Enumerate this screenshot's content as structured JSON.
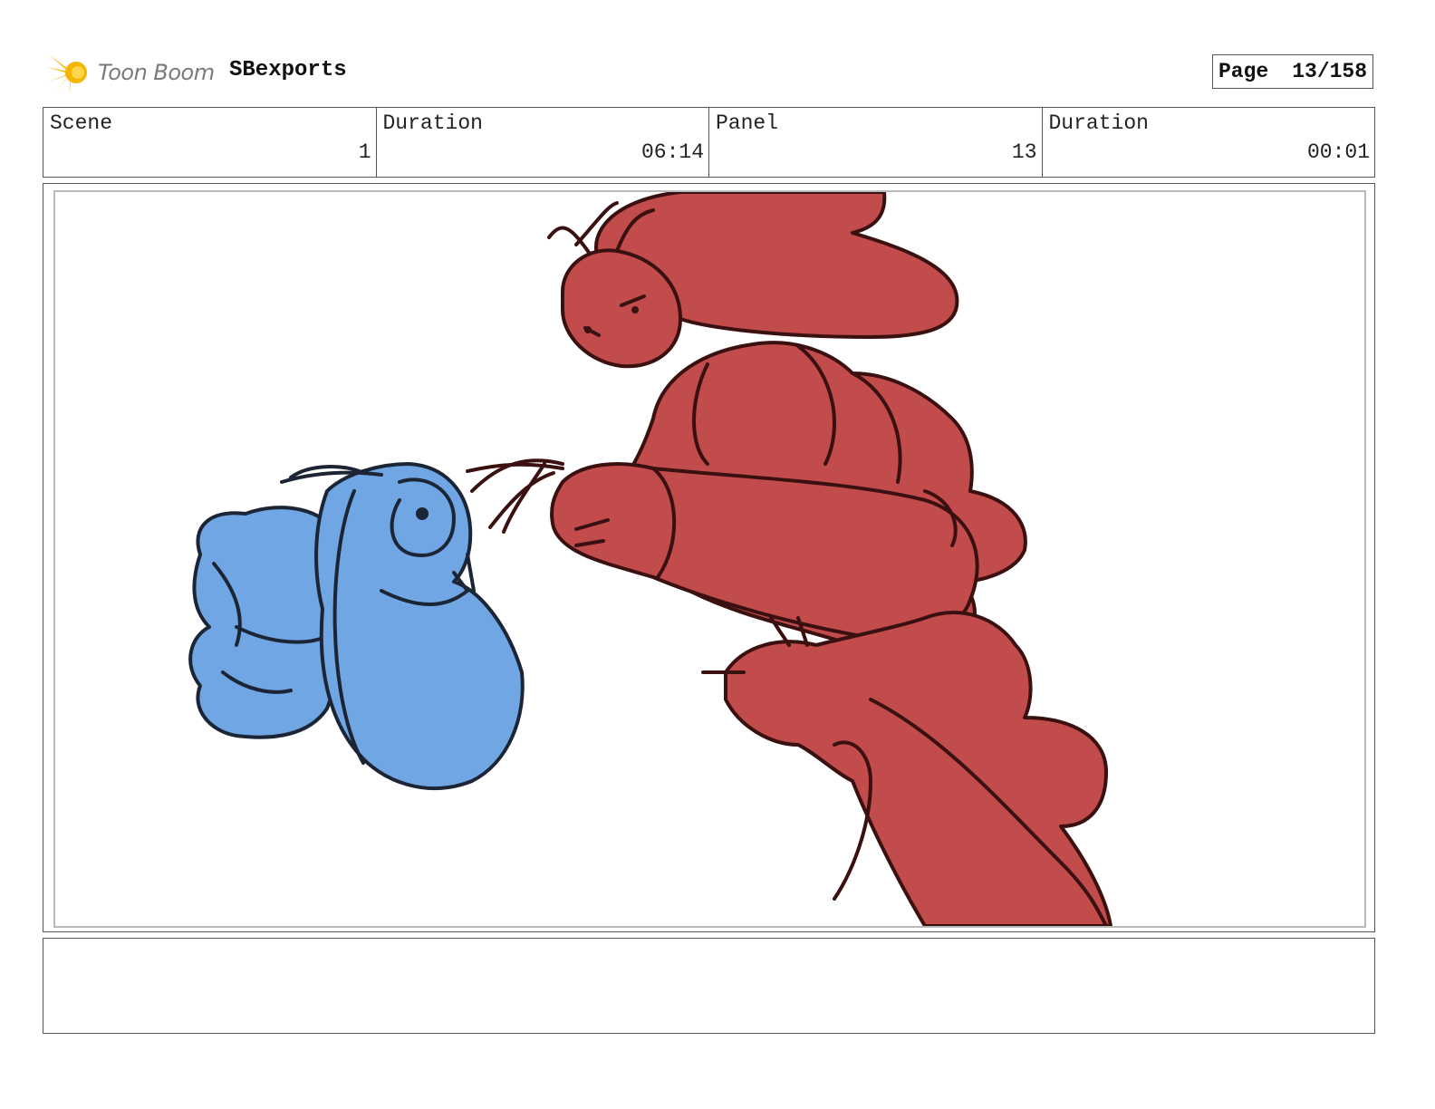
{
  "header": {
    "logo_text": "Toon Boom",
    "project_title": "SBexports",
    "page_label": "Page",
    "page_number": "13/158"
  },
  "info": {
    "scene_label": "Scene",
    "scene_value": "1",
    "scene_duration_label": "Duration",
    "scene_duration_value": "06:14",
    "panel_label": "Panel",
    "panel_value": "13",
    "panel_duration_label": "Duration",
    "panel_duration_value": "00:01"
  },
  "panel": {
    "colors": {
      "bee_fill": "#6fa6e3",
      "bee_line": "#1c2535",
      "creature_fill": "#c24b4b",
      "creature_line": "#3a1010"
    }
  },
  "notes": {
    "text": ""
  }
}
